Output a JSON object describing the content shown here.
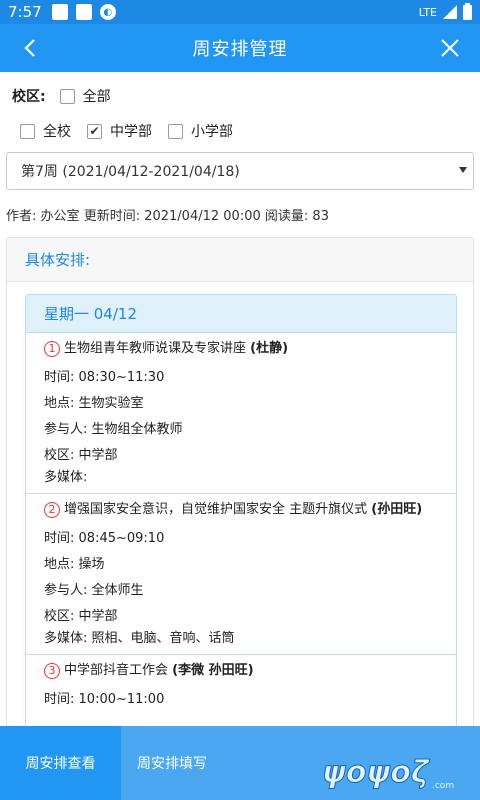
{
  "status": {
    "time": "7:57",
    "network": "LTE"
  },
  "appbar": {
    "title": "周安排管理"
  },
  "filters": {
    "campus_label": "校区:",
    "all_label": "全部",
    "options": [
      {
        "label": "全校",
        "checked": false
      },
      {
        "label": "中学部",
        "checked": true
      },
      {
        "label": "小学部",
        "checked": false
      }
    ]
  },
  "week_select": {
    "value": "第7周 (2021/04/12-2021/04/18)"
  },
  "meta": {
    "author_label": "作者:",
    "author": "办公室",
    "updated_label": "更新时间:",
    "updated": "2021/04/12 00:00",
    "reads_label": "阅读量:",
    "reads": "83"
  },
  "panel": {
    "title": "具体安排:"
  },
  "day": {
    "title": "星期一 04/12"
  },
  "labels": {
    "time": "时间:",
    "place": "地点:",
    "participants": "参与人:",
    "campus": "校区:",
    "media": "多媒体:"
  },
  "items": [
    {
      "num": "1",
      "title": "生物组青年教师说课及专家讲座",
      "owner": "(杜静)",
      "time": "08:30~11:30",
      "place": "生物实验室",
      "participants": "生物组全体教师",
      "campus": "中学部",
      "media": ""
    },
    {
      "num": "2",
      "title": "增强国家安全意识，自觉维护国家安全 主题升旗仪式",
      "owner": "(孙田旺)",
      "time": "08:45~09:10",
      "place": "操场",
      "participants": "全体师生",
      "campus": "中学部",
      "media": "照相、电脑、音响、话筒"
    },
    {
      "num": "3",
      "title": "中学部抖音工作会",
      "owner": "(李微 孙田旺)",
      "time": "10:00~11:00",
      "place": "",
      "participants": "",
      "campus": "",
      "media": ""
    }
  ],
  "bottom_tabs": {
    "view": "周安排查看",
    "fill": "周安排填写"
  },
  "watermark": "ψοψοζ.com"
}
